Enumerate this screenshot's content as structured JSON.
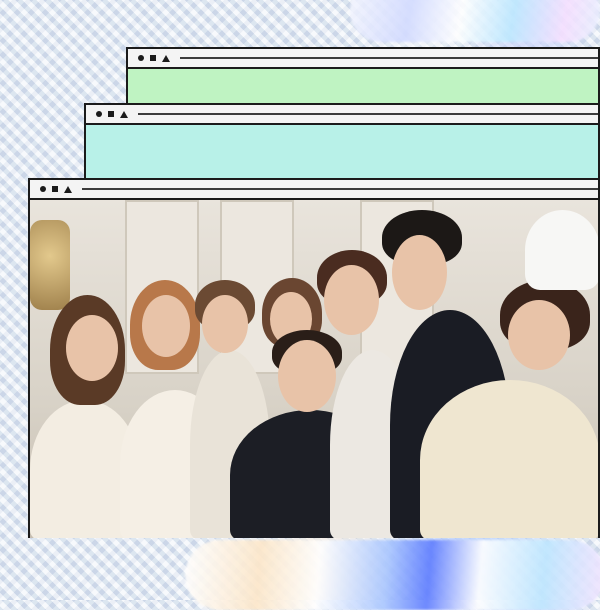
{
  "icons": [
    "circle-icon",
    "square-icon",
    "triangle-icon"
  ],
  "colors": {
    "window_1_pane": "#bff3c2",
    "window_2_pane": "#b8f1e8",
    "frame": "#1b1b1b"
  }
}
